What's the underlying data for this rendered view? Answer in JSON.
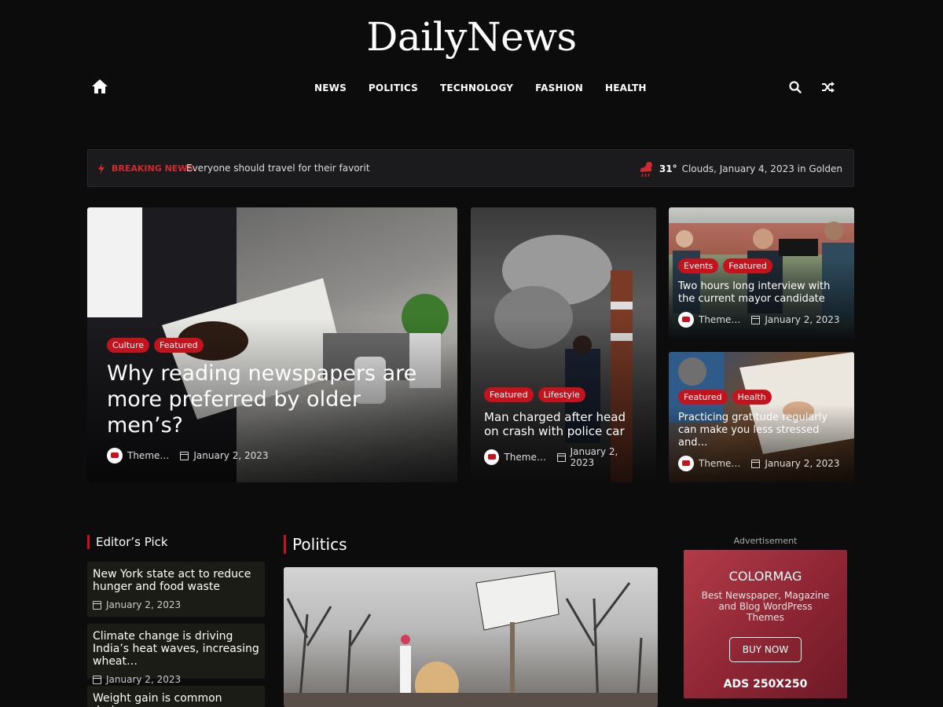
{
  "site": {
    "logo": "DailyNews"
  },
  "nav": {
    "items": [
      "NEWS",
      "POLITICS",
      "TECHNOLOGY",
      "FASHION",
      "HEALTH"
    ]
  },
  "breaking": {
    "label": "BREAKING NEWS",
    "headline": "Everyone should travel for their favorit",
    "weather_temp": "31°",
    "weather_text": "Clouds, January 4, 2023 in Golden"
  },
  "hero": {
    "main": {
      "tags": [
        "Culture",
        "Featured"
      ],
      "title": "Why reading newspapers are more preferred by older men’s?",
      "author": "Theme…",
      "date": "January 2, 2023"
    },
    "middle": {
      "tags": [
        "Featured",
        "Lifestyle"
      ],
      "title": "Man charged after head on crash with police car",
      "author": "Theme…",
      "date": "January 2, 2023"
    },
    "top_right": {
      "tags": [
        "Events",
        "Featured"
      ],
      "title": "Two hours long interview with the current mayor candidate",
      "author": "Theme…",
      "date": "January 2, 2023"
    },
    "bottom_right": {
      "tags": [
        "Featured",
        "Health"
      ],
      "title": "Practicing gratitude regularly can make you less stressed and…",
      "author": "Theme…",
      "date": "January 2, 2023"
    }
  },
  "editors_pick": {
    "heading": "Editor’s Pick",
    "items": [
      {
        "title": "New York state act to reduce hunger and food waste",
        "date": "January 2, 2023"
      },
      {
        "title": "Climate change is driving India’s heat waves, increasing wheat…",
        "date": "January 2, 2023"
      },
      {
        "title": "Weight gain is common during"
      }
    ]
  },
  "politics": {
    "heading": "Politics"
  },
  "ad": {
    "label": "Advertisement",
    "brand": "COLORMAG",
    "subtitle": "Best Newspaper, Magazine and Blog WordPress Themes",
    "button": "BUY NOW",
    "size": "ADS 250X250"
  },
  "colors": {
    "accent": "#c4131c",
    "background": "#0c0c0d",
    "breaking_bg": "#1b1b1d"
  },
  "icons": {
    "home": "home-icon",
    "search": "search-icon",
    "random": "shuffle-icon",
    "breaking": "bolt-icon",
    "weather": "cloud-rain-sun-icon",
    "date": "calendar-icon"
  }
}
